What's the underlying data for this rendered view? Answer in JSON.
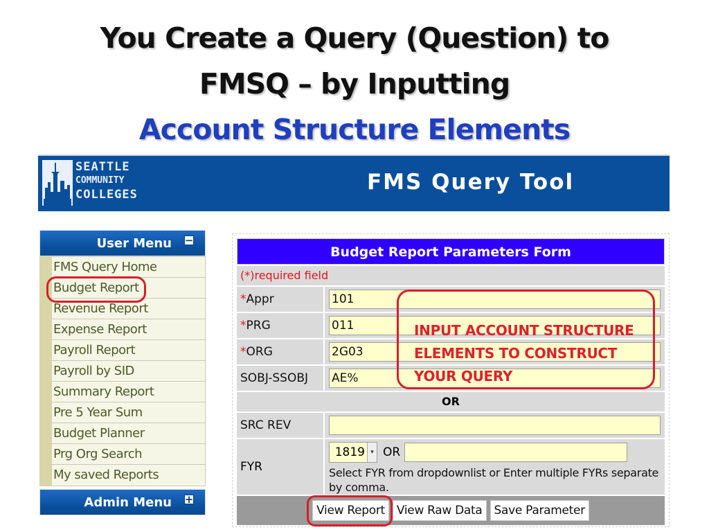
{
  "slide": {
    "title_line1": "You Create a Query (Question) to",
    "title_line2": "FMSQ – by Inputting",
    "title_line3": "Account Structure Elements"
  },
  "banner": {
    "logo_line1": "SEATTLE",
    "logo_line2": "COMMUNITY",
    "logo_line3": "COLLEGES",
    "title": "FMS Query Tool",
    "brand_color": "#0a4f9c"
  },
  "user_menu": {
    "header": "User Menu",
    "toggle_symbol": "−",
    "items": [
      {
        "label": "FMS Query Home"
      },
      {
        "label": "Budget Report",
        "highlighted": true
      },
      {
        "label": "Revenue Report"
      },
      {
        "label": "Expense Report"
      },
      {
        "label": "Payroll Report"
      },
      {
        "label": "Payroll by SID"
      },
      {
        "label": "Summary Report"
      },
      {
        "label": "Pre 5 Year Sum"
      },
      {
        "label": "Budget Planner"
      },
      {
        "label": "Prg Org Search"
      },
      {
        "label": "My saved Reports"
      }
    ]
  },
  "admin_menu": {
    "header": "Admin Menu",
    "toggle_symbol": "+"
  },
  "form": {
    "header": "Budget Report Parameters Form",
    "required_note": "(*)required field",
    "fields": [
      {
        "label": "Appr",
        "required": "*",
        "value": "101"
      },
      {
        "label": "PRG",
        "required": "*",
        "value": "011"
      },
      {
        "label": "ORG",
        "required": "*",
        "value": "2G03"
      },
      {
        "label": "SOBJ-SSOBJ",
        "required": "",
        "value": "AE%"
      }
    ],
    "or_divider": "OR",
    "src_rev": {
      "label": "SRC REV",
      "value": ""
    },
    "fyr": {
      "label": "FYR",
      "selected": "1819",
      "dropdown_arrow": "▾",
      "or_text": "OR",
      "text_value": "",
      "help": "Select FYR from dropdownlist or Enter multiple FYRs separate by comma."
    },
    "buttons": {
      "view_report": "View Report",
      "view_raw_data": "View Raw Data",
      "save_parameter": "Save Parameter"
    }
  },
  "callout": {
    "line1": "INPUT ACCOUNT STRUCTURE",
    "line2": "ELEMENTS TO CONSTRUCT",
    "line3": "YOUR QUERY",
    "color": "#e0202b"
  }
}
